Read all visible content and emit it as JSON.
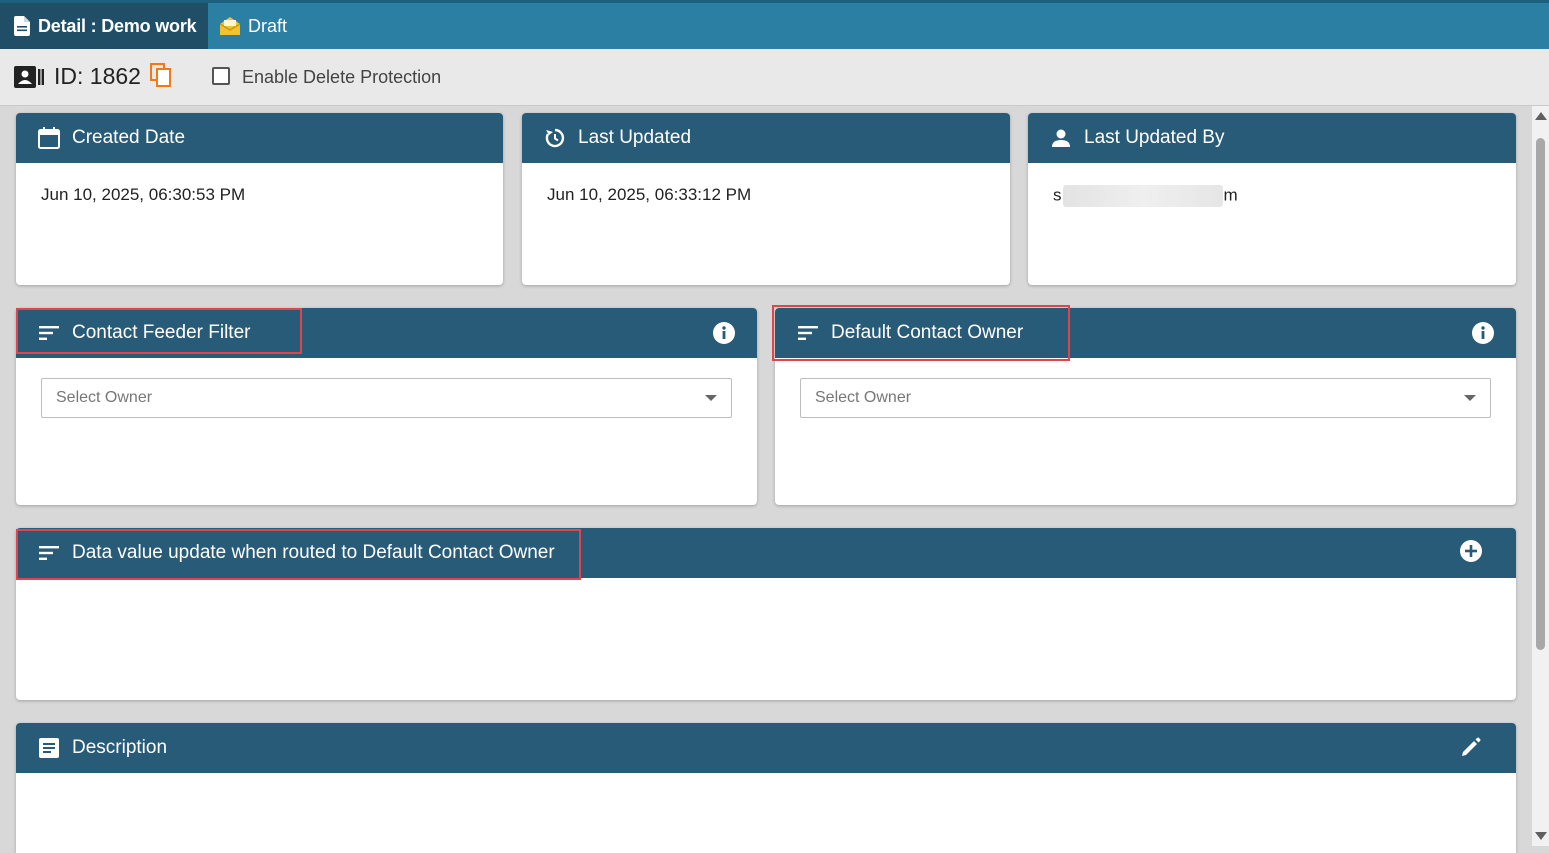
{
  "tabs": [
    {
      "label": "Detail : Demo work"
    },
    {
      "label": "Draft"
    }
  ],
  "record": {
    "id_label": "ID: 1862",
    "delete_protection_label": "Enable Delete Protection"
  },
  "cards": {
    "created": {
      "title": "Created Date",
      "value": "Jun 10, 2025, 06:30:53 PM"
    },
    "updated": {
      "title": "Last Updated",
      "value": "Jun 10, 2025, 06:33:12 PM"
    },
    "updated_by": {
      "title": "Last Updated By",
      "value_start": "s",
      "value_end": "m"
    },
    "feeder_filter": {
      "title": "Contact Feeder Filter",
      "placeholder": "Select Owner"
    },
    "default_owner": {
      "title": "Default Contact Owner",
      "placeholder": "Select Owner"
    },
    "data_update": {
      "title": "Data value update when routed to Default Contact Owner"
    },
    "description": {
      "title": "Description"
    }
  },
  "colors": {
    "tabbar": "#2a7fa3",
    "active_tab": "#1f4e66",
    "card_header": "#285b78",
    "copy_icon": "#f07a1a",
    "draft_icon": "#f2c232",
    "highlight": "#e0454d"
  },
  "icons": {
    "detail_tab": "document-icon",
    "draft_tab": "envelope-open-icon",
    "id": "id-card-icon",
    "copy": "copy-icon",
    "created": "calendar-icon",
    "updated": "history-icon",
    "updated_by": "user-icon",
    "filter": "sort-lines-icon",
    "info": "info-icon",
    "add": "plus-circle-icon",
    "description": "note-icon",
    "edit": "pencil-icon"
  }
}
